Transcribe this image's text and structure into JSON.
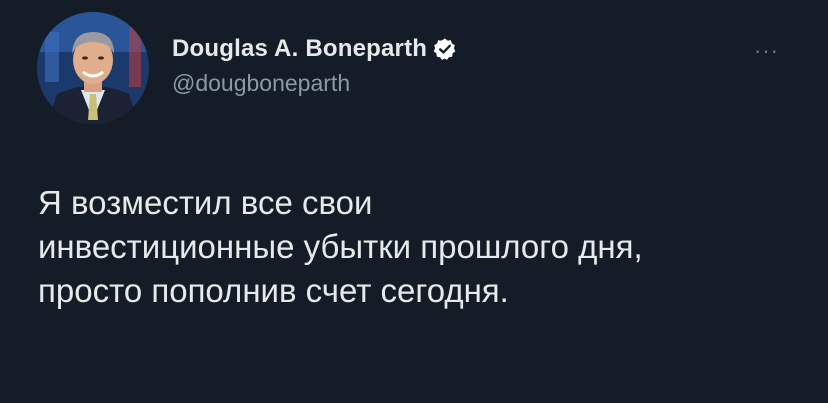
{
  "tweet": {
    "display_name": "Douglas A. Boneparth",
    "handle": "@dougboneparth",
    "verified": true,
    "more_icon": "more-horizontal-icon",
    "text": "Я возместил все свои\nинвестиционные убытки прошлого дня,\nпросто пополнив счет сегодня."
  },
  "colors": {
    "background": "#141d27",
    "name": "#e7e9ea",
    "handle": "#8b98a5",
    "verified_badge": "#ffffff"
  }
}
